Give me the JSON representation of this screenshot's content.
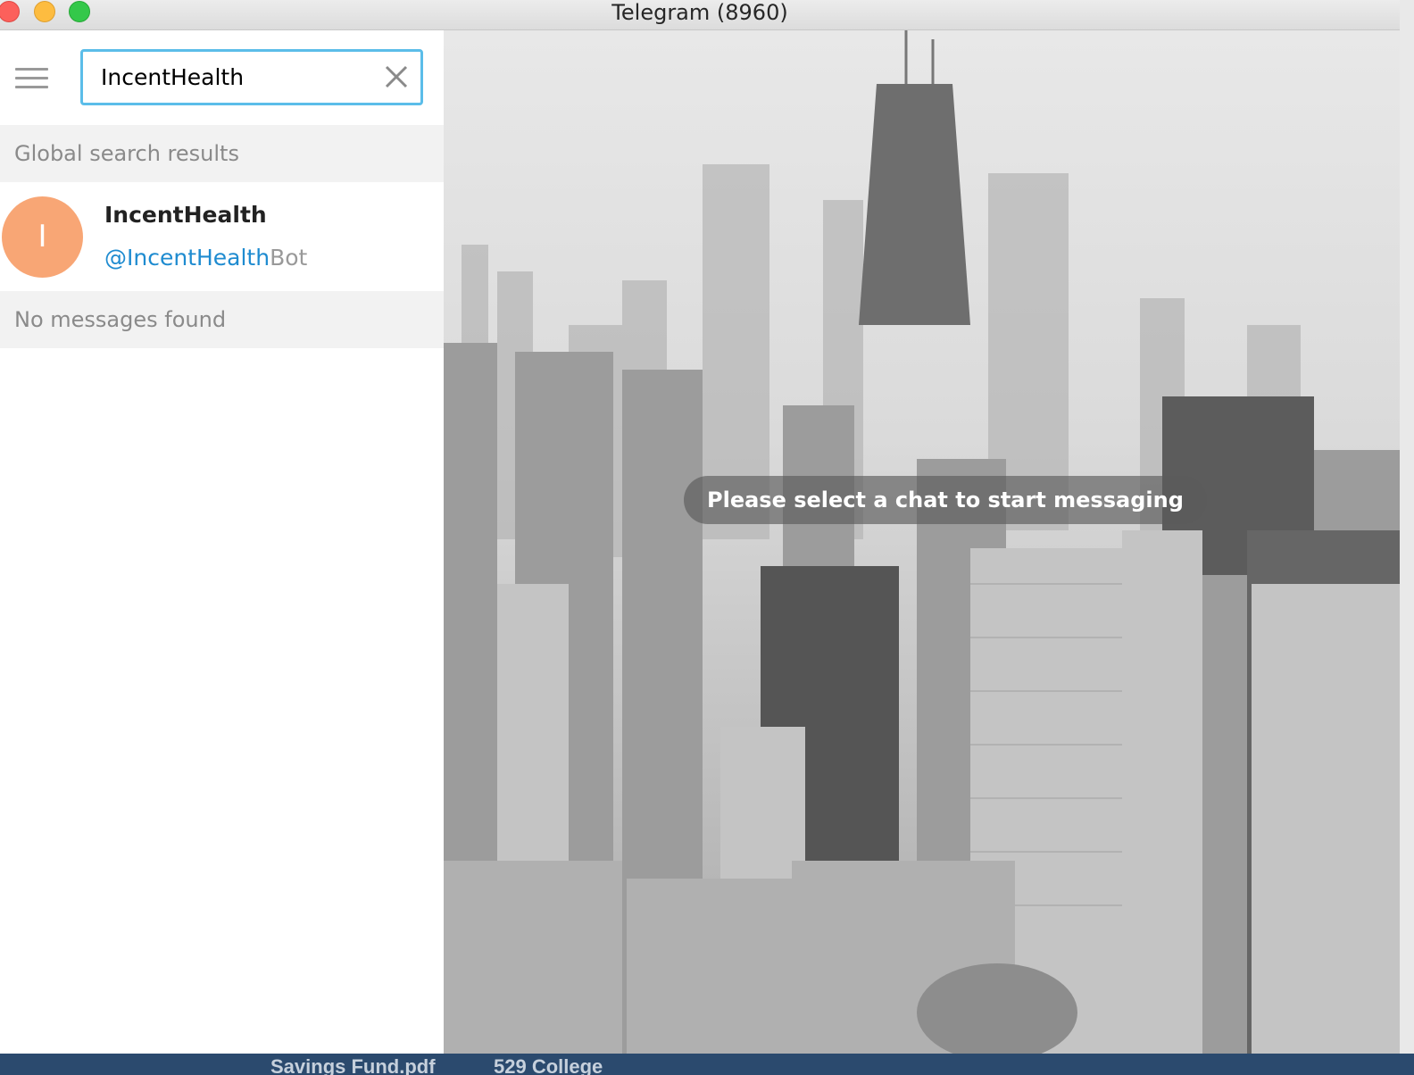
{
  "window": {
    "title": "Telegram (8960)"
  },
  "search": {
    "value": "IncentHealth",
    "clear_icon": "close-icon",
    "menu_icon": "hamburger-menu-icon"
  },
  "sections": {
    "global_header": "Global search results",
    "messages_header": "No messages found"
  },
  "results": [
    {
      "avatar_letter": "I",
      "avatar_color": "#f8a675",
      "name": "IncentHealth",
      "username_match": "@IncentHealth",
      "username_rest": "Bot"
    }
  ],
  "chat": {
    "empty_message": "Please select a chat to start messaging"
  },
  "desktop": {
    "file_label_1": "Savings Fund.pdf",
    "file_label_2": "529 College"
  },
  "colors": {
    "search_border": "#5bbde9",
    "username_match": "#1e8bd0",
    "section_bg": "#f2f2f2"
  }
}
